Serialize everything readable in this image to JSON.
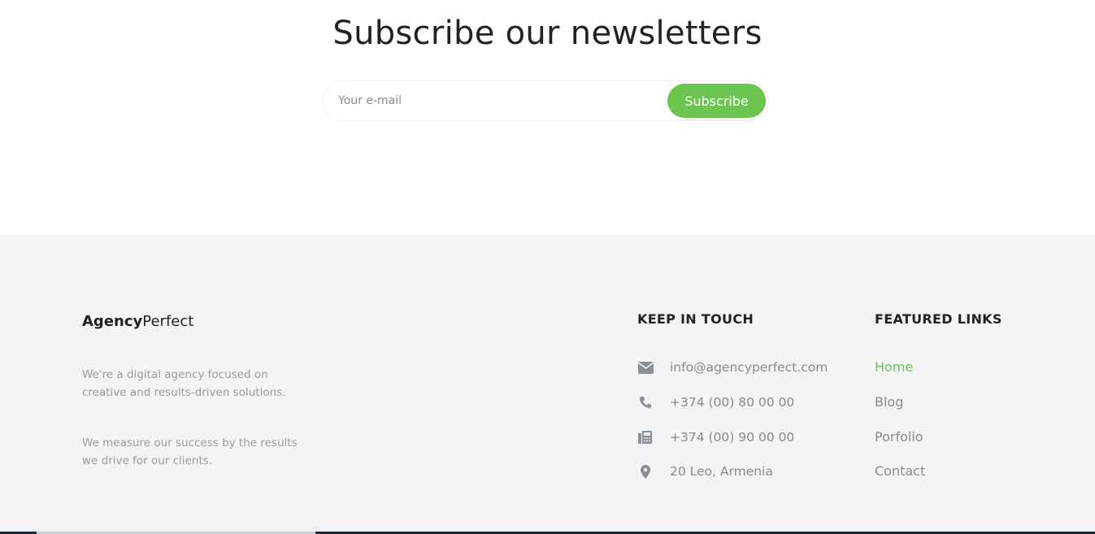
{
  "newsletter": {
    "title": "Subscribe our newsletters",
    "email_placeholder": "Your e-mail",
    "subscribe_label": "Subscribe"
  },
  "footer": {
    "brand_bold": "Agency",
    "brand_light": "Perfect",
    "about_1": "We're a digital agency focused on creative and results-driven solutions.",
    "about_2": "We measure our success by the results we drive for our clients.",
    "contact": {
      "title": "KEEP IN TOUCH",
      "email": "info@agencyperfect.com",
      "phone": "+374 (00) 80 00 00",
      "fax": "+374 (00) 90 00 00",
      "address": "20 Leo, Armenia"
    },
    "links": {
      "title": "FEATURED LINKS",
      "items": [
        "Home",
        "Blog",
        "Porfolio",
        "Contact"
      ]
    }
  },
  "colors": {
    "accent": "#6cc551",
    "footer_bg": "#f4f4f6",
    "muted_text": "#8a8a8a"
  },
  "icons": {
    "email": "envelope-icon",
    "phone": "phone-icon",
    "fax": "fax-icon",
    "address": "map-marker-icon"
  }
}
